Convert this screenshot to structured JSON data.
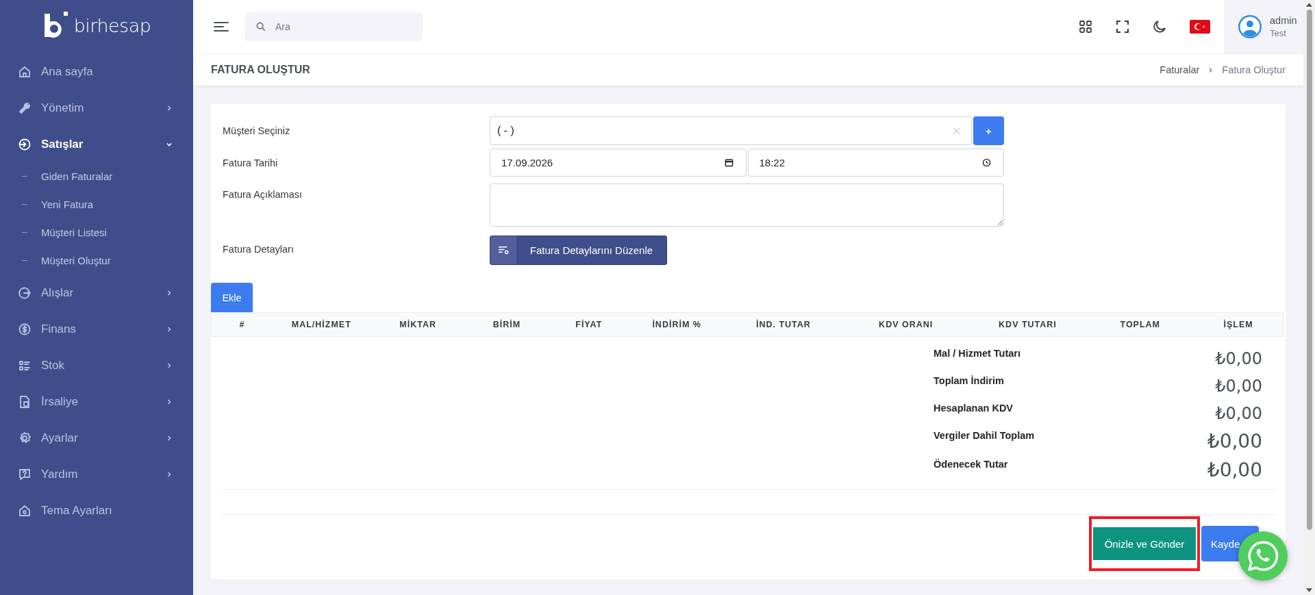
{
  "sidebar": {
    "logo_text": "birhesap",
    "items": [
      {
        "label": "Ana sayfa",
        "selected": false
      },
      {
        "label": "Yönetim",
        "expanded": false,
        "selected": false
      },
      {
        "label": "Satışlar",
        "expanded": true,
        "selected": true,
        "children": [
          {
            "label": "Giden Faturalar",
            "selected": false
          },
          {
            "label": "Yeni Fatura",
            "selected": false
          },
          {
            "label": "Müşteri Listesi",
            "selected": false
          },
          {
            "label": "Müşteri Oluştur",
            "selected": false
          }
        ]
      },
      {
        "label": "Alışlar",
        "expanded": false,
        "selected": false
      },
      {
        "label": "Finans",
        "expanded": false,
        "selected": false
      },
      {
        "label": "Stok",
        "expanded": false,
        "selected": false
      },
      {
        "label": "İrsaliye",
        "expanded": false,
        "selected": false
      },
      {
        "label": "Ayarlar",
        "expanded": false,
        "selected": false
      },
      {
        "label": "Yardım",
        "expanded": false,
        "selected": false
      },
      {
        "label": "Tema Ayarları",
        "selected": false
      }
    ]
  },
  "topbar": {
    "search": {
      "placeholder": "Ara"
    },
    "user": {
      "name": "admin",
      "role": "Test"
    }
  },
  "page_header": {
    "title": "FATURA OLUŞTUR",
    "breadcrumb": [
      "Faturalar",
      "Fatura Oluştur"
    ]
  },
  "form": {
    "customer": {
      "label": "Müşteri Seçiniz",
      "value": "( - )",
      "add_button": "+"
    },
    "date": {
      "label": "Fatura Tarihi",
      "date": "17.09.2026",
      "time": "18:22"
    },
    "description": {
      "label": "Fatura Açıklaması"
    },
    "details": {
      "label": "Fatura Detayları",
      "button": "Fatura Detaylarını Düzenle"
    }
  },
  "add_button": "Ekle",
  "table": {
    "columns": [
      "#",
      "MAL/HİZMET",
      "MİKTAR",
      "BİRİM",
      "FİYAT",
      "İNDİRİM %",
      "İND. TUTAR",
      "KDV ORANI",
      "KDV TUTARI",
      "TOPLAM",
      "İŞLEM"
    ]
  },
  "totals": [
    {
      "label": "Mal / Hizmet Tutarı",
      "value": "₺0,00",
      "emphasis": false
    },
    {
      "label": "Toplam İndirim",
      "value": "₺0,00",
      "emphasis": false
    },
    {
      "label": "Hesaplanan KDV",
      "value": "₺0,00",
      "emphasis": false
    },
    {
      "label": "Vergiler Dahil Toplam",
      "value": "₺0,00",
      "emphasis": true
    },
    {
      "label": "Ödenecek Tutar",
      "value": "₺0,00",
      "emphasis": true
    }
  ],
  "actions": [
    {
      "label": "Önizle ve Gönder",
      "kind": "preview",
      "highlighted": true
    },
    {
      "label": "Kayde",
      "kind": "save",
      "highlighted": false
    }
  ]
}
